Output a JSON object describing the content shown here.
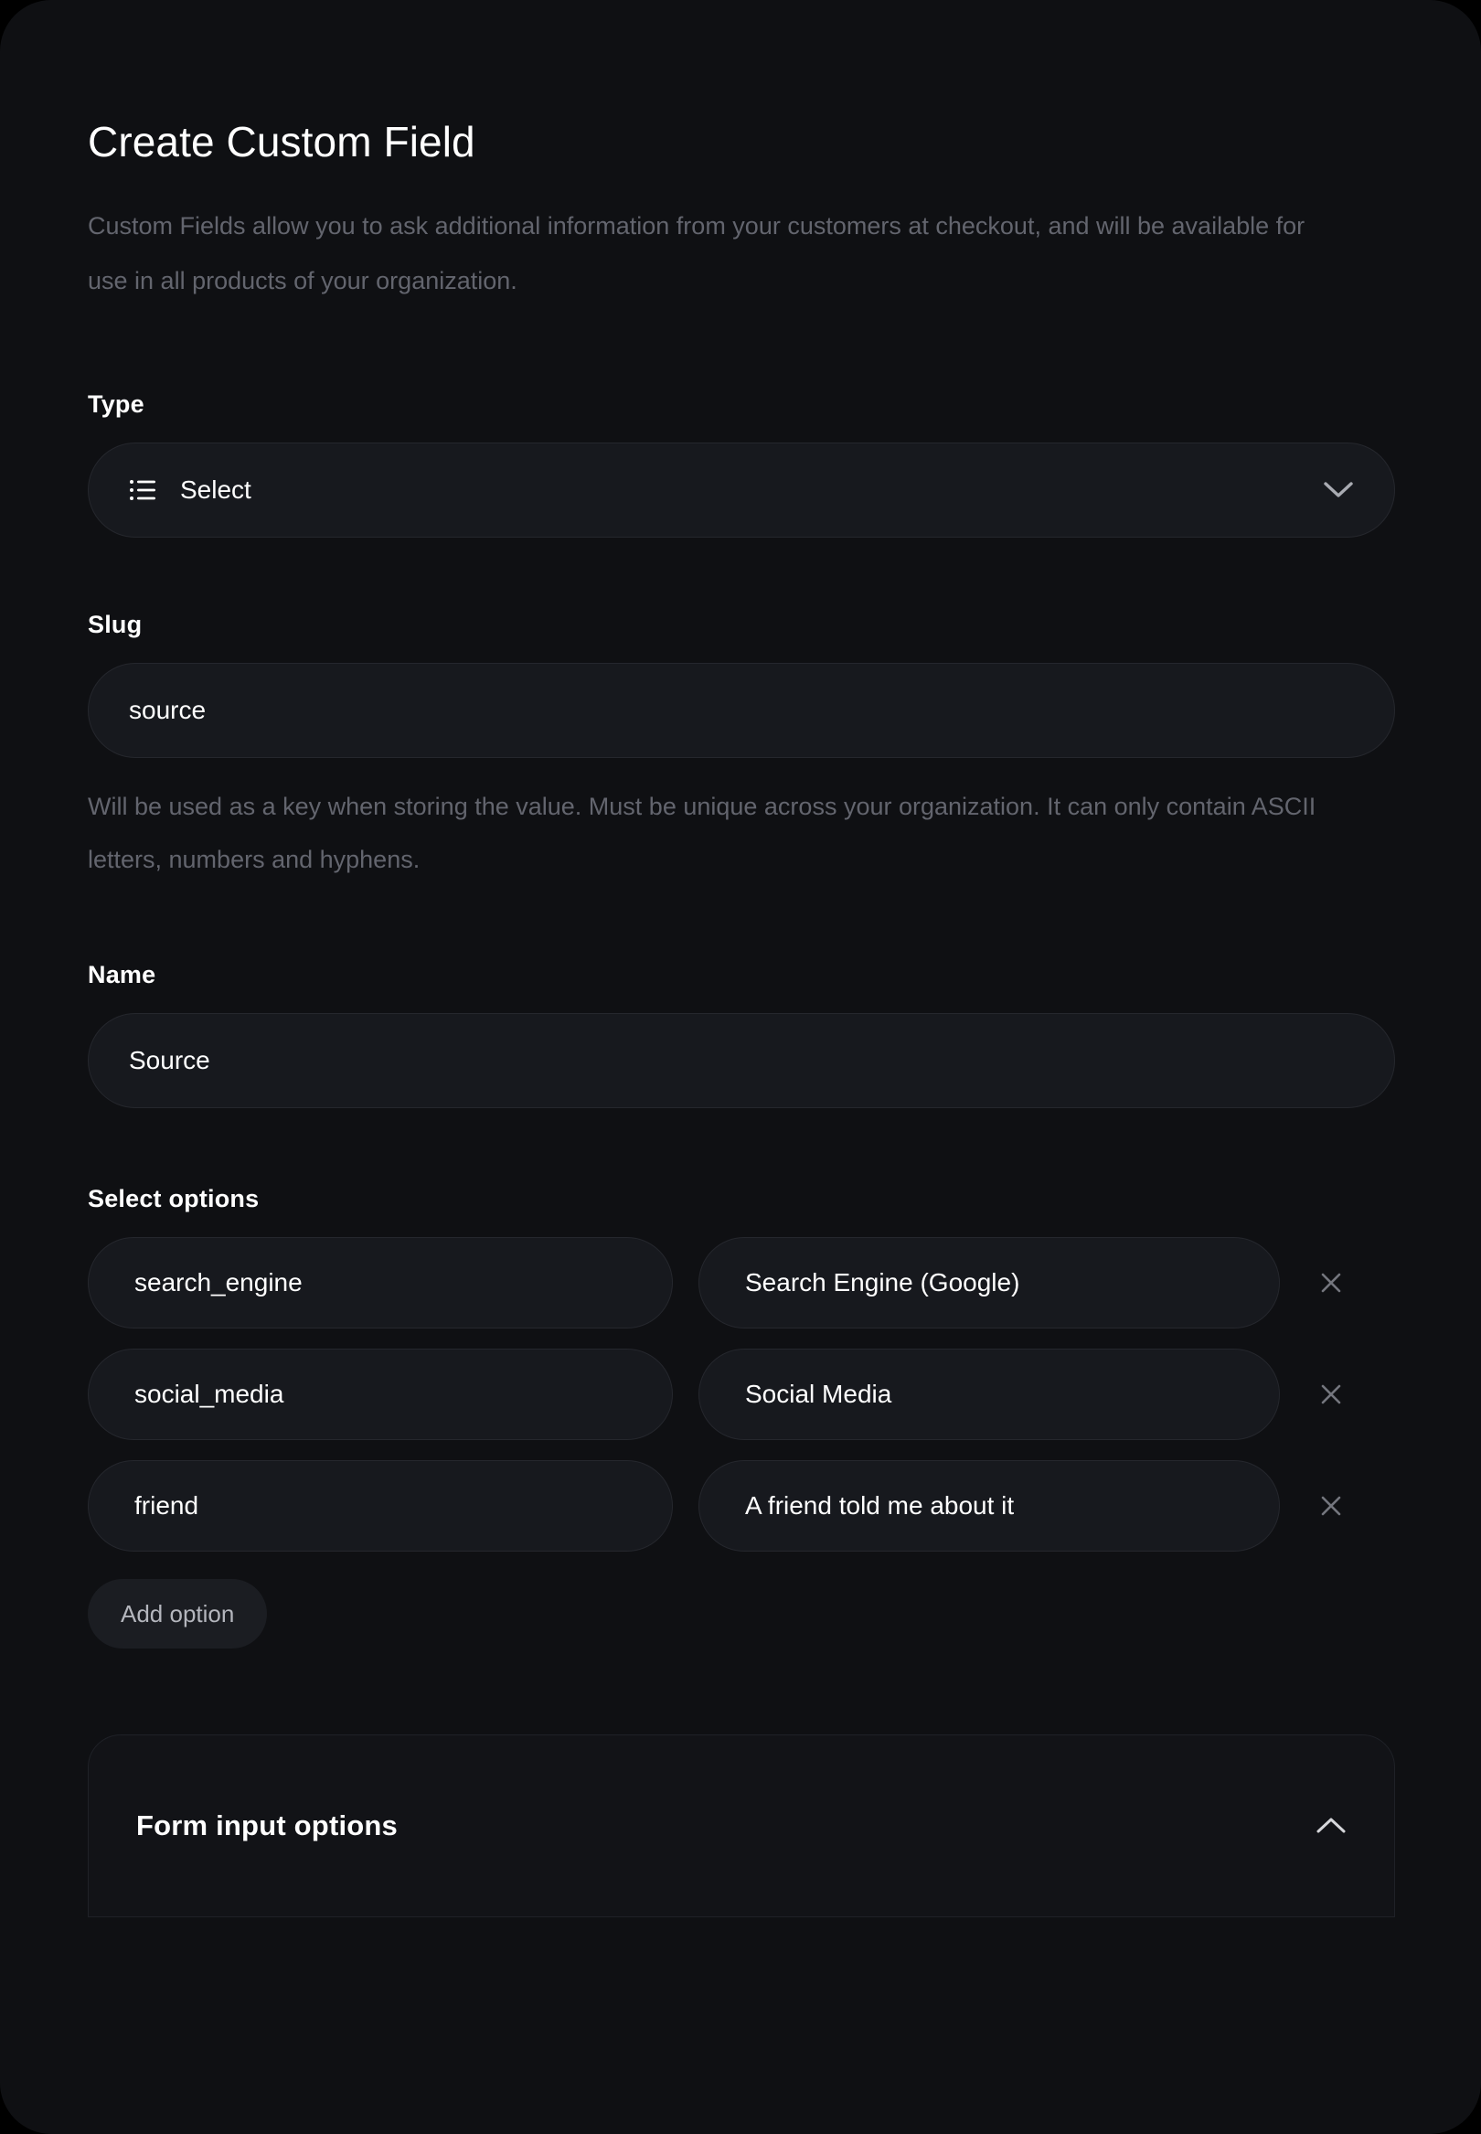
{
  "panel": {
    "title": "Create Custom Field",
    "description": "Custom Fields allow you to ask additional information from your customers at checkout, and will be available for use in all products of your organization."
  },
  "type_field": {
    "label": "Type",
    "icon": "list-icon",
    "value": "Select",
    "chevron": "chevron-down-icon"
  },
  "slug_field": {
    "label": "Slug",
    "value": "source",
    "helper": "Will be used as a key when storing the value. Must be unique across your organization. It can only contain ASCII letters, numbers and hyphens."
  },
  "name_field": {
    "label": "Name",
    "value": "Source"
  },
  "select_options": {
    "label": "Select options",
    "rows": [
      {
        "key": "search_engine",
        "label": "Search Engine (Google)",
        "remove_icon": "close-icon"
      },
      {
        "key": "social_media",
        "label": "Social Media",
        "remove_icon": "close-icon"
      },
      {
        "key": "friend",
        "label": "A friend told me about it",
        "remove_icon": "close-icon"
      }
    ],
    "add_button": "Add option"
  },
  "form_input_options": {
    "title": "Form input options",
    "chevron": "chevron-up-icon",
    "expanded": true
  },
  "colors": {
    "page_background": "#000000",
    "panel_background": "#0f1013",
    "input_background": "#17191e",
    "input_border": "#25272d",
    "text_primary": "#ffffff",
    "text_muted": "#63656e",
    "button_background": "#1b1d22",
    "button_text": "#b4b6bd",
    "icon_muted": "#74767e"
  }
}
